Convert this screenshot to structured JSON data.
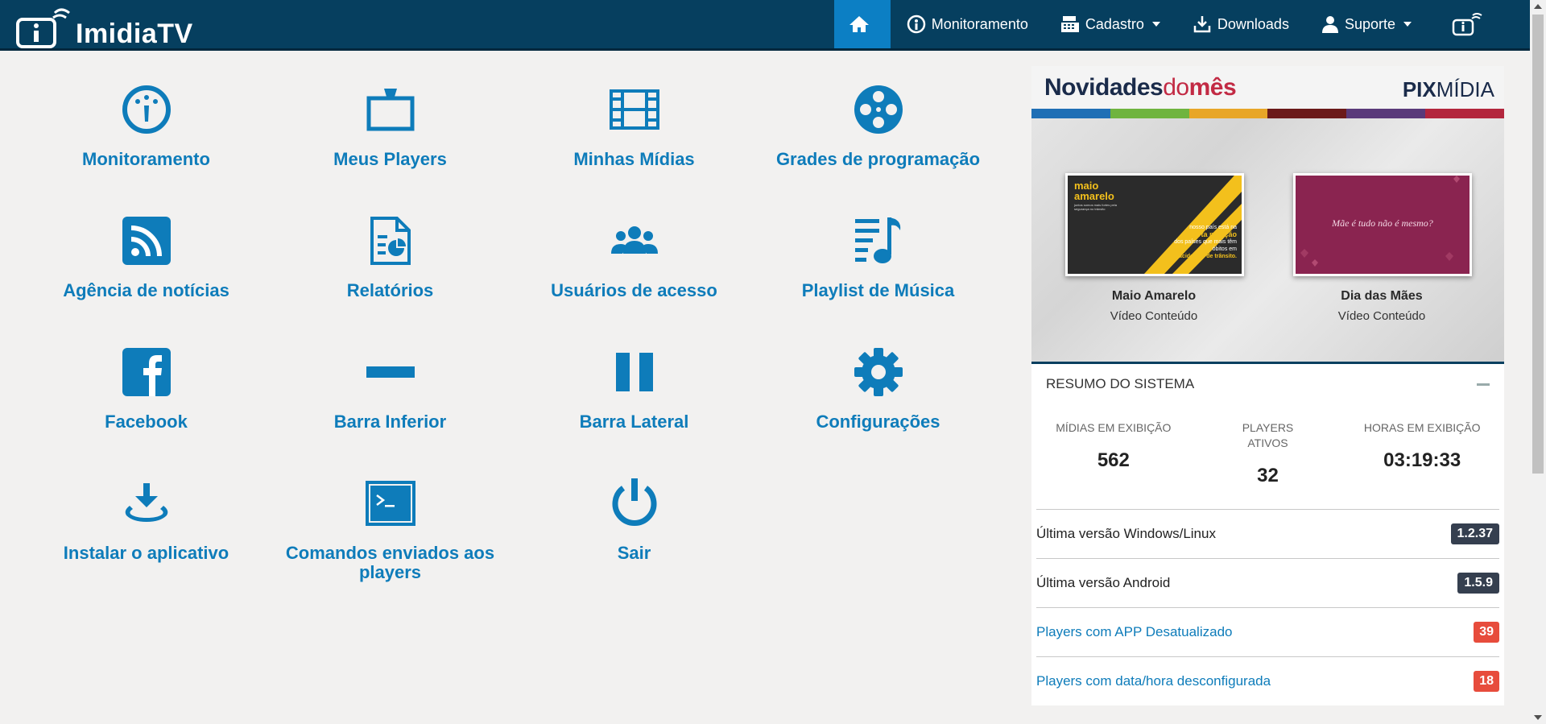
{
  "app": {
    "brand": "ImidiaTV"
  },
  "navbar": {
    "items": [
      {
        "label": "Monitoramento",
        "icon": "gauge-icon"
      },
      {
        "label": "Cadastro",
        "icon": "cashier-icon"
      },
      {
        "label": "Downloads",
        "icon": "download-icon"
      },
      {
        "label": "Suporte",
        "icon": "user-icon"
      }
    ]
  },
  "menu": {
    "items": [
      {
        "label": "Monitoramento",
        "icon": "gauge-icon"
      },
      {
        "label": "Meus Players",
        "icon": "tv-icon"
      },
      {
        "label": "Minhas Mídias",
        "icon": "film-icon"
      },
      {
        "label": "Grades de programação",
        "icon": "film-reel-icon"
      },
      {
        "label": "Agência de notícias",
        "icon": "rss-icon"
      },
      {
        "label": "Relatórios",
        "icon": "report-icon"
      },
      {
        "label": "Usuários de acesso",
        "icon": "users-icon"
      },
      {
        "label": "Playlist de Música",
        "icon": "music-playlist-icon"
      },
      {
        "label": "Facebook",
        "icon": "facebook-icon"
      },
      {
        "label": "Barra Inferior",
        "icon": "bottom-bar-icon"
      },
      {
        "label": "Barra Lateral",
        "icon": "side-bar-icon"
      },
      {
        "label": "Configurações",
        "icon": "gear-icon"
      },
      {
        "label": "Instalar o aplicativo",
        "icon": "install-icon"
      },
      {
        "label": "Comandos enviados aos players",
        "icon": "terminal-icon"
      },
      {
        "label": "Sair",
        "icon": "power-icon"
      }
    ]
  },
  "banner": {
    "title_bold": "Novidades",
    "title_thin": "do",
    "title_red": "mês",
    "brand_pix": "PIX",
    "brand_midia": "MÍDIA",
    "strip_colors": [
      "#1f6fb5",
      "#6fb43f",
      "#e8a628",
      "#6b1a1a",
      "#5a3a7a",
      "#b3263d"
    ],
    "cards": [
      {
        "title": "Maio Amarelo",
        "subtitle": "Vídeo Conteúdo",
        "img_heading": "maio amarelo",
        "img_small": "juntos somos mais fortes pela segurança no trânsito",
        "img_line1": "nosso país está na",
        "img_line2": "quarta posição",
        "img_line3": "dos países que mais têm óbitos em",
        "img_line4": "acidentes de trânsito."
      },
      {
        "title": "Dia das Mães",
        "subtitle": "Vídeo Conteúdo",
        "img_text": "Mãe é tudo não é mesmo?"
      }
    ]
  },
  "summary": {
    "title": "RESUMO DO SISTEMA",
    "stats": [
      {
        "label": "MÍDIAS EM EXIBIÇÃO",
        "value": "562"
      },
      {
        "label": "PLAYERS ATIVOS",
        "value": "32"
      },
      {
        "label": "HORAS EM EXIBIÇÃO",
        "value": "03:19:33"
      }
    ],
    "rows": [
      {
        "label": "Última versão Windows/Linux",
        "badge": "1.2.37",
        "badge_color": "#353f4f"
      },
      {
        "label": "Última versão Android",
        "badge": "1.5.9",
        "badge_color": "#353f4f"
      },
      {
        "label": "Players com APP Desatualizado",
        "badge": "39",
        "badge_color": "#e74c3c"
      },
      {
        "label": "Players com data/hora desconfigurada",
        "badge": "18",
        "badge_color": "#e74c3c"
      }
    ]
  },
  "colors": {
    "navbar_bg": "#063f5f",
    "nav_active": "#0c7fc4",
    "accent": "#0e7cba",
    "page_bg": "#f2f1f0"
  }
}
